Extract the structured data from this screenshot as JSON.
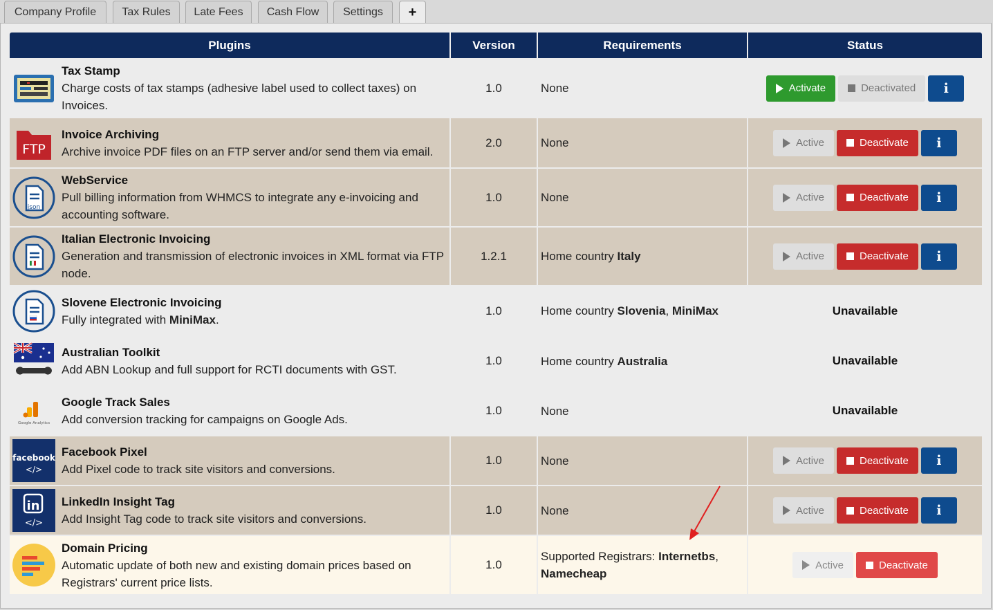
{
  "tabs": [
    {
      "label": "Company Profile"
    },
    {
      "label": "Tax Rules"
    },
    {
      "label": "Late Fees"
    },
    {
      "label": "Cash Flow"
    },
    {
      "label": "Settings"
    },
    {
      "label": "+"
    }
  ],
  "table": {
    "headers": [
      "Plugins",
      "Version",
      "Requirements",
      "Status"
    ],
    "rows": [
      {
        "name": "Tax Stamp",
        "desc": "Charge costs of tax stamps (adhesive label used to collect taxes) on Invoices.",
        "version": "1.0",
        "req_text": "None",
        "req_bold": "",
        "req_sep": "",
        "req_bold2": "",
        "req_end": "",
        "status": "inactive",
        "icon": "tax-stamp-icon"
      },
      {
        "name": "Invoice Archiving",
        "desc": "Archive invoice PDF files on an FTP server and/or send them via email.",
        "version": "2.0",
        "req_text": "None",
        "req_bold": "",
        "req_sep": "",
        "req_bold2": "",
        "req_end": "",
        "status": "active",
        "icon": "ftp-folder-icon",
        "icon_text": "FTP"
      },
      {
        "name": "WebService",
        "desc": "Pull billing information from WHMCS to integrate any e-invoicing and accounting software.",
        "version": "1.0",
        "req_text": "None",
        "req_bold": "",
        "req_sep": "",
        "req_bold2": "",
        "req_end": "",
        "status": "active",
        "icon": "json-document-icon",
        "icon_text": "json"
      },
      {
        "name": "Italian Electronic Invoicing",
        "desc": "Generation and transmission of electronic invoices in XML format via FTP node.",
        "version": "1.2.1",
        "req_text": "Home country ",
        "req_bold": "Italy",
        "req_sep": "",
        "req_bold2": "",
        "req_end": "",
        "status": "active",
        "icon": "italy-invoice-icon"
      },
      {
        "name": "Slovene Electronic Invoicing",
        "desc_pre": "Fully integrated with ",
        "desc_bold": "MiniMax",
        "desc_post": ".",
        "version": "1.0",
        "req_text": "Home country ",
        "req_bold": "Slovenia",
        "req_sep": ", ",
        "req_bold2": "MiniMax",
        "req_end": "",
        "status": "unavailable",
        "icon": "slovenia-invoice-icon"
      },
      {
        "name": "Australian Toolkit",
        "desc": "Add ABN Lookup and full support for RCTI documents with GST.",
        "version": "1.0",
        "req_text": "Home country ",
        "req_bold": "Australia",
        "req_sep": "",
        "req_bold2": "",
        "req_end": "",
        "status": "unavailable",
        "icon": "australia-wrench-icon"
      },
      {
        "name": "Google Track Sales",
        "desc": "Add conversion tracking for campaigns on Google Ads.",
        "version": "1.0",
        "req_text": "None",
        "req_bold": "",
        "req_sep": "",
        "req_bold2": "",
        "req_end": "",
        "status": "unavailable",
        "icon": "google-analytics-icon",
        "icon_text": "Google Analytics"
      },
      {
        "name": "Facebook Pixel",
        "desc": "Add Pixel code to track site visitors and conversions.",
        "version": "1.0",
        "req_text": "None",
        "req_bold": "",
        "req_sep": "",
        "req_bold2": "",
        "req_end": "",
        "status": "active",
        "icon": "facebook-code-icon",
        "icon_text": "facebook"
      },
      {
        "name": "LinkedIn Insight Tag",
        "desc": "Add Insight Tag code to track site visitors and conversions.",
        "version": "1.0",
        "req_text": "None",
        "req_bold": "",
        "req_sep": "",
        "req_bold2": "",
        "req_end": "",
        "status": "active",
        "icon": "linkedin-code-icon",
        "icon_text": "in"
      },
      {
        "name": "Domain Pricing",
        "desc": "Automatic update of both new and existing domain prices based on Registrars' current price lists.",
        "version": "1.0",
        "req_text": "Supported Registrars: ",
        "req_bold": "Internetbs",
        "req_sep": ",",
        "req_bold2": "Namecheap",
        "req_end": "",
        "status": "active-highlight",
        "icon": "domain-pricing-icon"
      }
    ]
  },
  "buttons": {
    "activate": "Activate",
    "deactivated": "Deactivated",
    "active": "Active",
    "deactivate": "Deactivate",
    "info": "i",
    "unavailable": "Unavailable"
  },
  "colors": {
    "header_bg": "#0e2a5c",
    "tan_row": "#d5cbbd",
    "highlight_row": "#fdf7ea",
    "green": "#2e9a2e",
    "red": "#c62c2c",
    "blue": "#0e4b8e",
    "annotation_arrow": "#e02020"
  }
}
